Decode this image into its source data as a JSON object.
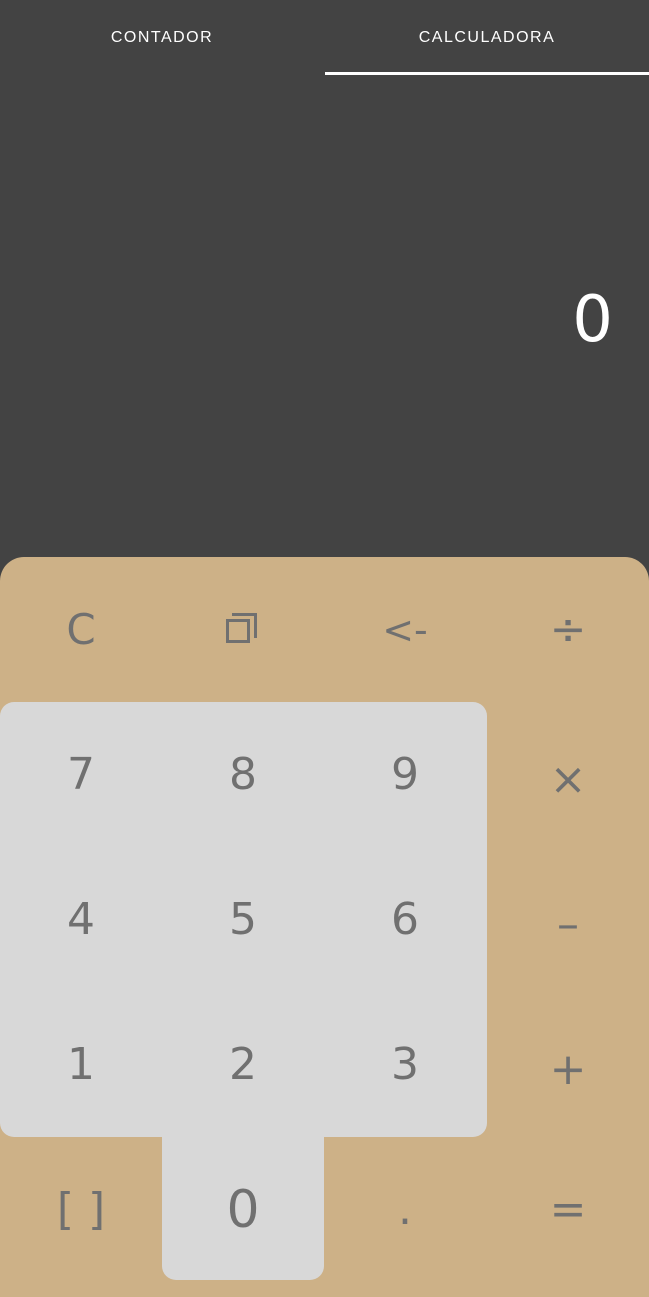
{
  "tabs": [
    {
      "label": "CONTADOR",
      "selected": false
    },
    {
      "label": "CALCULADORA",
      "selected": true
    }
  ],
  "display": {
    "value": "0"
  },
  "colors": {
    "background": "#434343",
    "pad": "#cdb187",
    "numpad": "#d8d8d8",
    "key_text": "#707070"
  },
  "keys": {
    "clear": "C",
    "copy_icon": "copy-icon",
    "backspace": "<-",
    "divide": "÷",
    "multiply": "×",
    "minus": "–",
    "plus": "+",
    "brackets": "[ ]",
    "dot": ".",
    "equals": "=",
    "d7": "7",
    "d8": "8",
    "d9": "9",
    "d4": "4",
    "d5": "5",
    "d6": "6",
    "d1": "1",
    "d2": "2",
    "d3": "3",
    "d0": "0"
  }
}
